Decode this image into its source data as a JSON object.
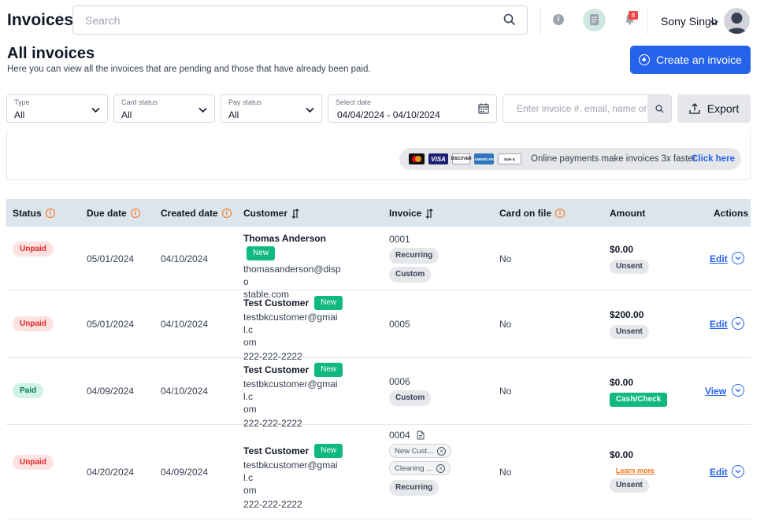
{
  "app": {
    "title": "Invoices"
  },
  "search": {
    "placeholder": "Search"
  },
  "user": {
    "name": "Sony Singh",
    "notification_count": "8"
  },
  "header": {
    "title": "All invoices",
    "subtitle": "Here you can view all the invoices that are pending and those that have already been paid.",
    "create_label": "Create an invoice"
  },
  "filters": {
    "type": {
      "label": "Type",
      "value": "All"
    },
    "card_status": {
      "label": "Card status",
      "value": "All"
    },
    "pay_status": {
      "label": "Pay status",
      "value": "All"
    },
    "date": {
      "label": "Select date",
      "value": "04/04/2024 - 04/10/2024"
    },
    "invoice_search_placeholder": "Enter invoice #, email, name or",
    "export_label": "Export"
  },
  "promo": {
    "text": "Online payments make invoices 3x faster.",
    "link": "Click here",
    "card_logos": [
      "mastercard-icon",
      "visa-icon",
      "discover-icon",
      "amex-icon",
      "safe-secure-icon"
    ]
  },
  "table": {
    "columns": [
      "Status",
      "Due date",
      "Created date",
      "Customer",
      "Invoice",
      "Card on file",
      "Amount",
      "Actions"
    ],
    "rows": [
      {
        "status": "Unpaid",
        "due": "05/01/2024",
        "created": "04/10/2024",
        "customer": "Thomas Anderson",
        "new_tag": "New",
        "email_lines": [
          "thomasanderson@dispo",
          "stable.com"
        ],
        "phone": "",
        "invoice_no": "0001",
        "chips": [
          "Recurring",
          "Custom"
        ],
        "card_on_file": "No",
        "amount": "$0.00",
        "amount_status": "Unsent",
        "action": "Edit"
      },
      {
        "status": "Unpaid",
        "due": "05/01/2024",
        "created": "04/10/2024",
        "customer": "Test Customer",
        "new_tag": "New",
        "email_lines": [
          "testbkcustomer@gmail.c",
          "om"
        ],
        "phone": "222-222-2222",
        "invoice_no": "0005",
        "chips": [],
        "card_on_file": "No",
        "amount": "$200.00",
        "amount_status": "Unsent",
        "action": "Edit"
      },
      {
        "status": "Paid",
        "due": "04/09/2024",
        "created": "04/10/2024",
        "customer": "Test Customer",
        "new_tag": "New",
        "email_lines": [
          "testbkcustomer@gmail.c",
          "om"
        ],
        "phone": "222-222-2222",
        "invoice_no": "0006",
        "chips": [
          "Custom"
        ],
        "card_on_file": "No",
        "amount": "$0.00",
        "amount_status": "Cash/Check",
        "action": "View"
      },
      {
        "status": "Unpaid",
        "due": "04/20/2024",
        "created": "04/09/2024",
        "customer": "Test Customer",
        "new_tag": "New",
        "email_lines": [
          "testbkcustomer@gmail.c",
          "om"
        ],
        "phone": "222-222-2222",
        "invoice_no": "0004",
        "removable_chips": [
          "New Cust...",
          "Cleaning ..."
        ],
        "chips": [
          "Recurring"
        ],
        "card_on_file": "No",
        "amount": "$0.00",
        "learn_more": "Learn more",
        "amount_status": "Unsent",
        "action": "Edit"
      }
    ]
  },
  "colors": {
    "primary": "#2563eb",
    "success": "#10b981",
    "danger": "#dc2626",
    "warning": "#f97316",
    "header_bg": "#dde5ec"
  }
}
